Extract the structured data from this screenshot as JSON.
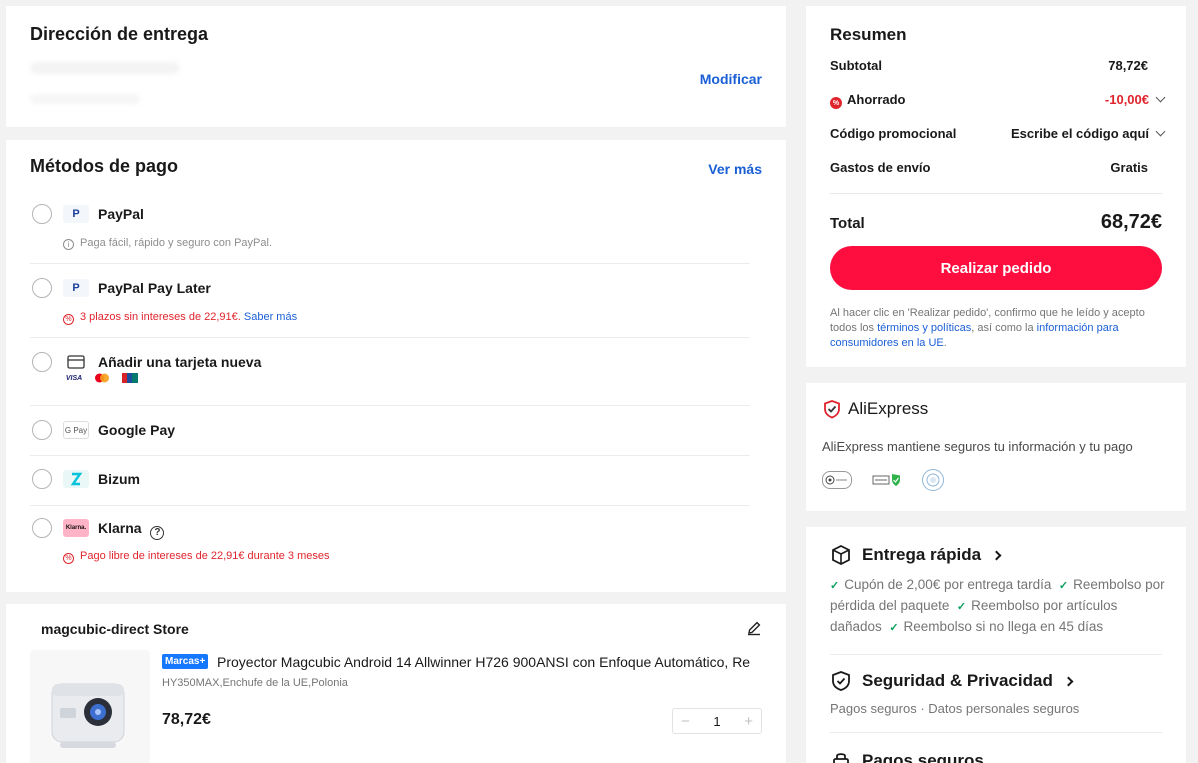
{
  "address": {
    "title": "Dirección de entrega",
    "modify_label": "Modificar"
  },
  "payment": {
    "title": "Métodos de pago",
    "see_more": "Ver más",
    "options": [
      {
        "name": "PayPal",
        "logo": "P",
        "note": "Paga fácil, rápido y seguro con PayPal."
      },
      {
        "name": "PayPal Pay Later",
        "logo": "P",
        "note": "3 plazos sin intereses de 22,91€.",
        "note_link": "Saber más"
      },
      {
        "name": "Añadir una tarjeta nueva",
        "logo": "card-icon",
        "cards": [
          "VISA",
          "mastercard",
          "UnionPay"
        ]
      },
      {
        "name": "Google Pay",
        "logo": "G Pay"
      },
      {
        "name": "Bizum",
        "logo": "bizum"
      },
      {
        "name": "Klarna",
        "logo": "Klarna.",
        "note": "Pago libre de intereses de 22,91€ durante 3 meses"
      }
    ]
  },
  "store": {
    "name": "magcubic-direct Store",
    "badge": "Marcas+",
    "product_title": "Proyector Magcubic Android 14 Allwinner H726 900ANSI con Enfoque Automático, Re",
    "variant": "HY350MAX,Enchufe de la UE,Polonia",
    "price": "78,72€",
    "qty": "1",
    "minus": "−",
    "plus": "+"
  },
  "summary": {
    "title": "Resumen",
    "subtotal_label": "Subtotal",
    "subtotal_value": "78,72€",
    "saved_label": "Ahorrado",
    "saved_value": "-10,00€",
    "promo_label": "Código promocional",
    "promo_value": "Escribe el código aquí",
    "shipping_label": "Gastos de envío",
    "shipping_value": "Gratis",
    "total_label": "Total",
    "total_value": "68,72€",
    "order_button": "Realizar pedido",
    "legal_1": "Al hacer clic en 'Realizar pedido', confirmo que he leído y acepto todos los ",
    "legal_link1": "términos y políticas",
    "legal_2": ", así como la ",
    "legal_link2": "información para consumidores en la UE",
    "legal_3": "."
  },
  "trust": {
    "brand": "AliExpress",
    "text": "AliExpress mantiene seguros tu información y tu pago"
  },
  "delivery": {
    "title": "Entrega rápida",
    "features": [
      "Cupón de 2,00€ por entrega tardía",
      "Reembolso por pérdida del paquete",
      "Reembolso por artículos dañados",
      "Reembolso si no llega en 45 días"
    ],
    "security_title": "Seguridad & Privacidad",
    "security_sub": "Pagos seguros · Datos personales seguros",
    "payments_title": "Pagos seguros"
  },
  "colors": {
    "accent_red": "#fd0e3f",
    "link_blue": "#1a5fd6",
    "check_green": "#08a05c"
  }
}
